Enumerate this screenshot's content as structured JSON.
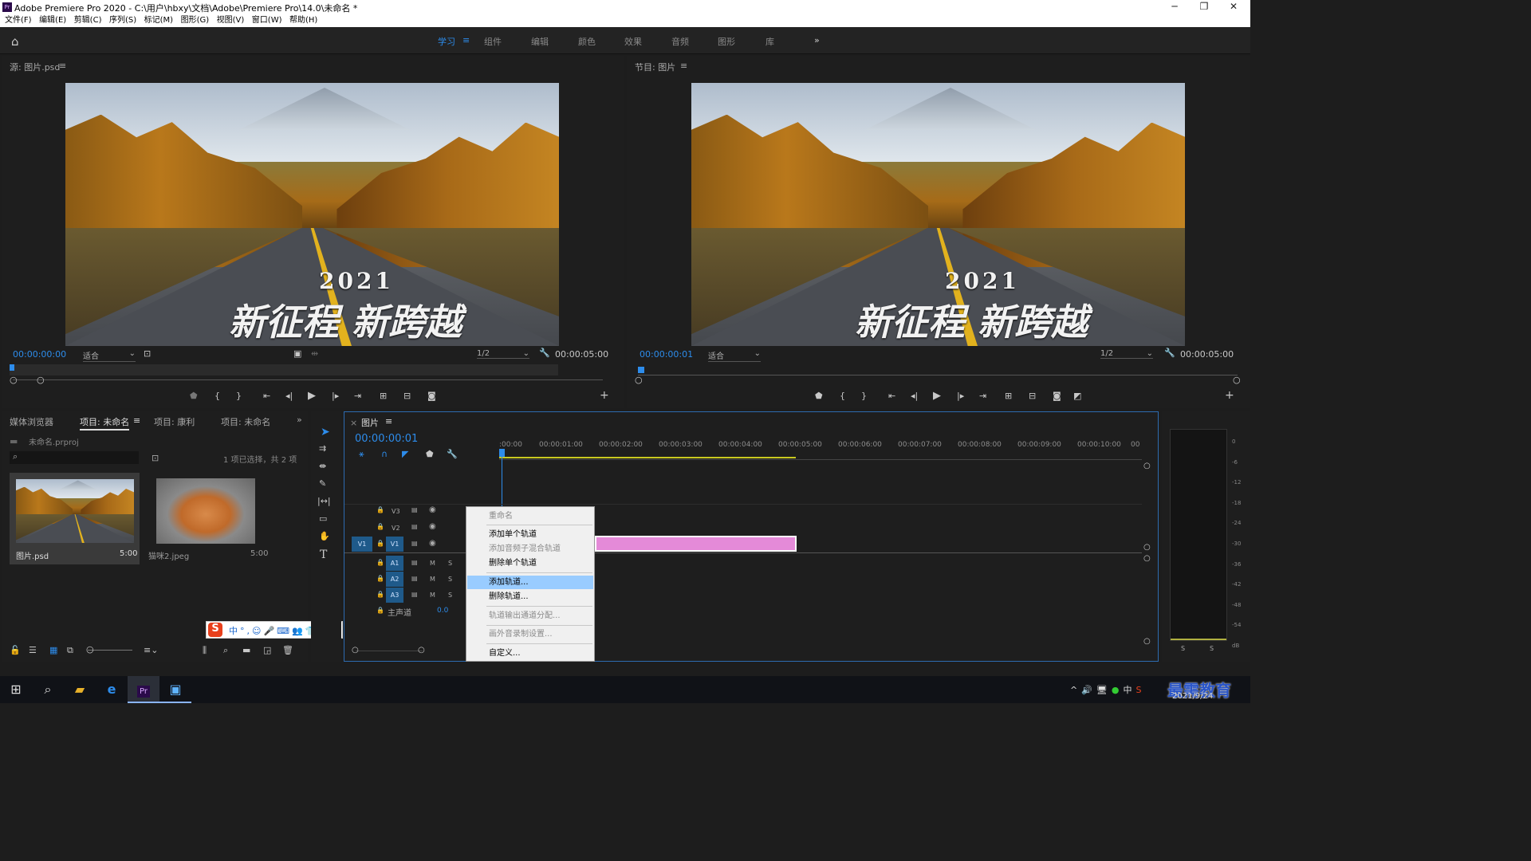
{
  "window": {
    "title": "Adobe Premiere Pro 2020 - C:\\用户\\hbxy\\文档\\Adobe\\Premiere Pro\\14.0\\未命名 *",
    "logo": "Pr",
    "min": "─",
    "max": "❐",
    "close": "✕"
  },
  "menubar": [
    "文件(F)",
    "编辑(E)",
    "剪辑(C)",
    "序列(S)",
    "标记(M)",
    "图形(G)",
    "视图(V)",
    "窗口(W)",
    "帮助(H)"
  ],
  "workspaces": {
    "items": [
      "学习",
      "组件",
      "编辑",
      "颜色",
      "效果",
      "音频",
      "图形",
      "库"
    ],
    "active": "学习",
    "menu_icon": "≡",
    "more": "»"
  },
  "source": {
    "title": "源: 图片.psd",
    "menu": "≡",
    "timecode": "00:00:00:00",
    "fit": "适合",
    "quality": "1/2",
    "duration": "00:00:05:00",
    "caption_year": "2021",
    "caption_text": "新征程 新跨越"
  },
  "program": {
    "title": "节目: 图片",
    "menu": "≡",
    "timecode": "00:00:00:01",
    "fit": "适合",
    "quality": "1/2",
    "duration": "00:00:05:00",
    "caption_year": "2021",
    "caption_text": "新征程 新跨越"
  },
  "project": {
    "tabs": [
      "媒体浏览器",
      "项目: 未命名",
      "项目: 康利",
      "项目: 未命名"
    ],
    "active_tab": "项目: 未命名",
    "menu": "≡",
    "more": "»",
    "file": "未命名.prproj",
    "status": "1 项已选择，共 2 项",
    "items": [
      {
        "name": "图片.psd",
        "duration": "5:00"
      },
      {
        "name": "猫咪2.jpeg",
        "duration": "5:00"
      }
    ]
  },
  "ime": {
    "logo": "S",
    "items": [
      "中",
      "°,",
      "☺",
      "🎤",
      "⌨",
      "👥",
      "👕",
      "▦"
    ]
  },
  "timeline": {
    "tab": "图片",
    "close": "×",
    "menu": "≡",
    "timecode": "00:00:00:01",
    "ruler": [
      ":00:00",
      "00:00:01:00",
      "00:00:02:00",
      "00:00:03:00",
      "00:00:04:00",
      "00:00:05:00",
      "00:00:06:00",
      "00:00:07:00",
      "00:00:08:00",
      "00:00:09:00",
      "00:00:10:00",
      "00"
    ],
    "video_tracks": [
      "V3",
      "V2",
      "V1"
    ],
    "audio_tracks": [
      "A1",
      "A2",
      "A3"
    ],
    "source_patch_v": "V1",
    "master": "主声道",
    "master_val": "0.0",
    "m": "M",
    "s": "S"
  },
  "context_menu": {
    "items": [
      {
        "label": "重命名",
        "disabled": true
      },
      {
        "label": "添加单个轨道",
        "disabled": false
      },
      {
        "label": "添加音频子混合轨道",
        "disabled": true
      },
      {
        "label": "删除单个轨道",
        "disabled": false
      },
      {
        "label": "添加轨道...",
        "selected": true
      },
      {
        "label": "删除轨道...",
        "disabled": false
      },
      {
        "label": "轨道输出通道分配...",
        "disabled": true
      },
      {
        "label": "画外音录制设置...",
        "disabled": true
      },
      {
        "label": "自定义...",
        "disabled": false
      }
    ]
  },
  "meter": {
    "scale": [
      "0",
      "-6",
      "-12",
      "-18",
      "-24",
      "-30",
      "-36",
      "-42",
      "-48",
      "-54",
      "dB"
    ],
    "s": "S"
  },
  "taskbar": {
    "date": "2021/9/24",
    "watermark": "最需教育",
    "tray": [
      "^",
      "🔊",
      "🖥",
      "●",
      "中",
      "S"
    ]
  }
}
